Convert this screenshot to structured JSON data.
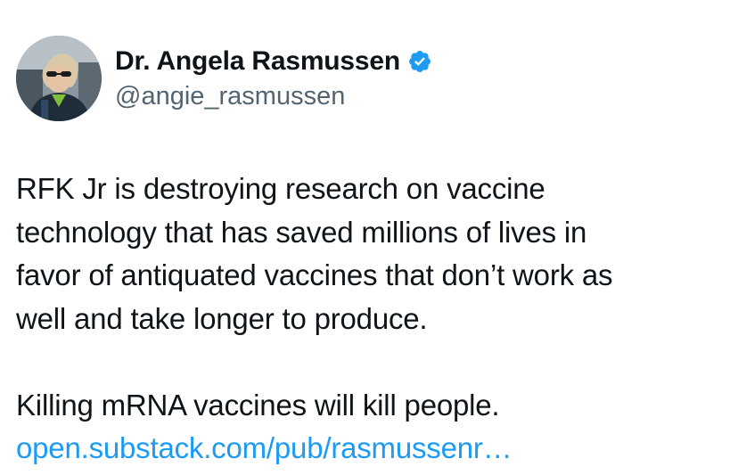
{
  "author": {
    "display_name": "Dr. Angela Rasmussen",
    "handle": "@angie_rasmussen",
    "verified_icon": "verified-badge-icon",
    "verified_color": "#1d9bf0"
  },
  "tweet": {
    "paragraph1_lines": [
      "RFK Jr is destroying research on vaccine",
      "technology that has saved millions of lives in",
      "favor of antiquated vaccines that don’t work as",
      "well and take longer to produce."
    ],
    "paragraph2": "Killing mRNA vaccines will kill people.",
    "link_text": "open.substack.com/pub/rasmussenr…",
    "link_color": "#1d9bf0"
  }
}
